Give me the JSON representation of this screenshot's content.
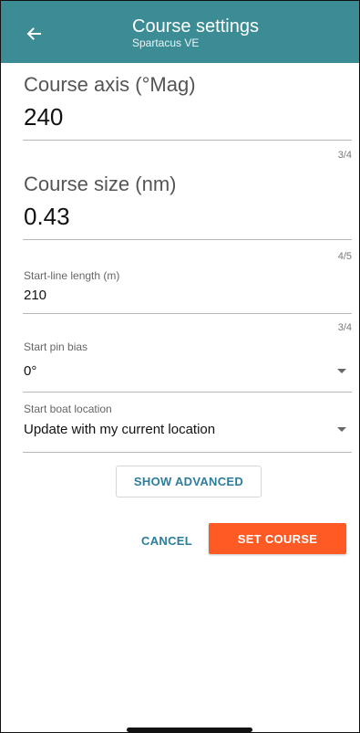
{
  "colors": {
    "appbar": "#3c8c96",
    "accent_text": "#2c7d9c",
    "primary_button": "#ff5a24"
  },
  "header": {
    "back_icon": "arrow-left-icon",
    "title": "Course settings",
    "subtitle": "Spartacus VE"
  },
  "fields": {
    "course_axis": {
      "label": "Course axis (°Mag)",
      "value": "240",
      "counter": "3/4"
    },
    "course_size": {
      "label": "Course size (nm)",
      "value": "0.43",
      "counter": "4/5"
    },
    "start_line_length": {
      "label": "Start-line length (m)",
      "value": "210",
      "counter": "3/4"
    },
    "start_pin_bias": {
      "label": "Start pin bias",
      "value": "0°",
      "icon": "chevron-down-icon"
    },
    "start_boat_location": {
      "label": "Start boat location",
      "value": "Update with my current location",
      "icon": "chevron-down-icon"
    }
  },
  "actions": {
    "show_advanced": "SHOW ADVANCED",
    "cancel": "CANCEL",
    "set_course": "SET COURSE"
  }
}
